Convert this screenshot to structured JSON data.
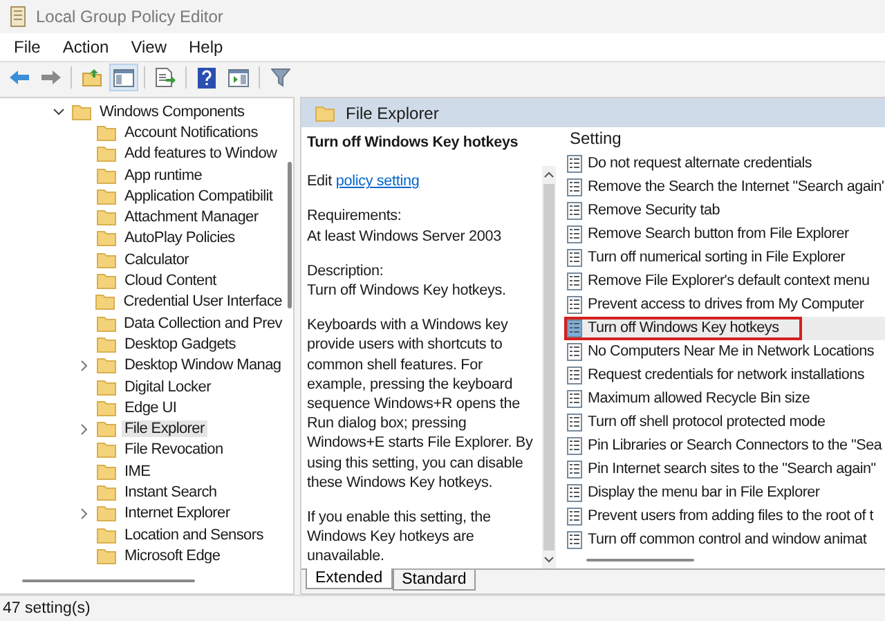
{
  "window": {
    "title": "Local Group Policy Editor"
  },
  "menu": [
    "File",
    "Action",
    "View",
    "Help"
  ],
  "toolbar": [
    {
      "kind": "back",
      "pressed": false
    },
    {
      "kind": "forward",
      "pressed": false
    },
    {
      "kind": "up",
      "pressed": false
    },
    {
      "kind": "tree",
      "pressed": true
    },
    {
      "kind": "export",
      "pressed": false
    },
    {
      "kind": "help",
      "pressed": false
    },
    {
      "kind": "view",
      "pressed": false
    },
    {
      "kind": "filter",
      "pressed": false
    }
  ],
  "tree": {
    "label": "Windows Components",
    "expanded": true,
    "children": [
      {
        "label": "Account Notifications",
        "expandable": false,
        "selected": false
      },
      {
        "label": "Add features to Window",
        "expandable": false,
        "selected": false
      },
      {
        "label": "App runtime",
        "expandable": false,
        "selected": false
      },
      {
        "label": "Application Compatibilit",
        "expandable": false,
        "selected": false
      },
      {
        "label": "Attachment Manager",
        "expandable": false,
        "selected": false
      },
      {
        "label": "AutoPlay Policies",
        "expandable": false,
        "selected": false
      },
      {
        "label": "Calculator",
        "expandable": false,
        "selected": false
      },
      {
        "label": "Cloud Content",
        "expandable": false,
        "selected": false
      },
      {
        "label": "Credential User Interface",
        "expandable": false,
        "selected": false
      },
      {
        "label": "Data Collection and Prev",
        "expandable": false,
        "selected": false
      },
      {
        "label": "Desktop Gadgets",
        "expandable": false,
        "selected": false
      },
      {
        "label": "Desktop Window Manag",
        "expandable": true,
        "selected": false
      },
      {
        "label": "Digital Locker",
        "expandable": false,
        "selected": false
      },
      {
        "label": "Edge UI",
        "expandable": false,
        "selected": false
      },
      {
        "label": "File Explorer",
        "expandable": true,
        "selected": true
      },
      {
        "label": "File Revocation",
        "expandable": false,
        "selected": false
      },
      {
        "label": "IME",
        "expandable": false,
        "selected": false
      },
      {
        "label": "Instant Search",
        "expandable": false,
        "selected": false
      },
      {
        "label": "Internet Explorer",
        "expandable": true,
        "selected": false
      },
      {
        "label": "Location and Sensors",
        "expandable": false,
        "selected": false
      },
      {
        "label": "Microsoft Edge",
        "expandable": false,
        "selected": false
      }
    ]
  },
  "details": {
    "header": "File Explorer",
    "title": "Turn off Windows Key hotkeys",
    "edit_prefix": "Edit",
    "edit_link": "policy setting",
    "blocks": [
      [
        "Requirements:",
        "At least Windows Server 2003"
      ],
      [
        "Description:",
        "Turn off Windows Key hotkeys."
      ],
      [
        "Keyboards with a Windows key provide users with shortcuts to common shell features. For example, pressing the keyboard sequence Windows+R opens the Run dialog box; pressing Windows+E starts File Explorer. By using this setting, you can disable these Windows Key hotkeys."
      ],
      [
        "If you enable this setting, the Windows Key hotkeys are unavailable."
      ]
    ]
  },
  "settings": {
    "column": "Setting",
    "rows": [
      {
        "label": "Do not request alternate credentials",
        "selected": false
      },
      {
        "label": "Remove the Search the Internet \"Search again\"",
        "selected": false
      },
      {
        "label": "Remove Security tab",
        "selected": false
      },
      {
        "label": "Remove Search button from File Explorer",
        "selected": false
      },
      {
        "label": "Turn off numerical sorting in File Explorer",
        "selected": false
      },
      {
        "label": "Remove File Explorer's default context menu",
        "selected": false
      },
      {
        "label": "Prevent access to drives from My Computer",
        "selected": false
      },
      {
        "label": "Turn off Windows Key hotkeys",
        "selected": true
      },
      {
        "label": "No Computers Near Me in Network Locations",
        "selected": false
      },
      {
        "label": "Request credentials for network installations",
        "selected": false
      },
      {
        "label": "Maximum allowed Recycle Bin size",
        "selected": false
      },
      {
        "label": "Turn off shell protocol protected mode",
        "selected": false
      },
      {
        "label": "Pin Libraries or Search Connectors to the \"Sea",
        "selected": false
      },
      {
        "label": "Pin Internet search sites to the \"Search again\"",
        "selected": false
      },
      {
        "label": "Display the menu bar in File Explorer",
        "selected": false
      },
      {
        "label": "Prevent users from adding files to the root of t",
        "selected": false
      },
      {
        "label": "Turn off common control and window animat",
        "selected": false
      }
    ]
  },
  "view_tabs": [
    {
      "label": "Extended",
      "selected": true
    },
    {
      "label": "Standard",
      "selected": false
    }
  ],
  "status_bar": "47 setting(s)"
}
